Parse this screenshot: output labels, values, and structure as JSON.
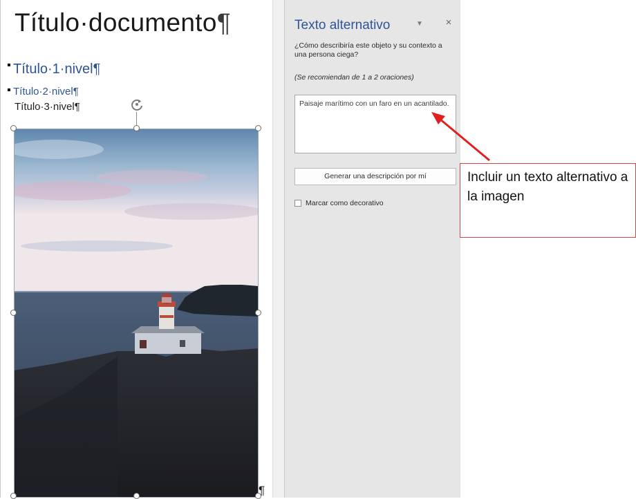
{
  "document": {
    "title": "Título·documento",
    "heading1": "Título·1·nivel",
    "heading2": "Título·2·nivel",
    "heading3": "Título·3·nivel",
    "pilcrow": "¶",
    "image_icon": "landscape-lighthouse-image"
  },
  "alt_text_pane": {
    "title": "Texto alternativo",
    "dropdown_icon": "chevron-down-icon",
    "close_icon": "close-icon",
    "close_glyph": "×",
    "dropdown_glyph": "▼",
    "question": "¿Cómo describiría este objeto y su contexto a una persona ciega?",
    "hint": "(Se recomiendan de 1 a 2 oraciones)",
    "alt_text_value": "Paisaje marítimo con un faro en un acantilado.",
    "generate_button": "Generar una descripción por mí",
    "decorative_label": "Marcar como decorativo",
    "decorative_checked": false
  },
  "callout": {
    "text": "Incluir un texto alternativo a la imagen",
    "color": "#e02020"
  },
  "colors": {
    "heading_blue": "#2f5496",
    "pane_background": "#e6e6e6"
  }
}
